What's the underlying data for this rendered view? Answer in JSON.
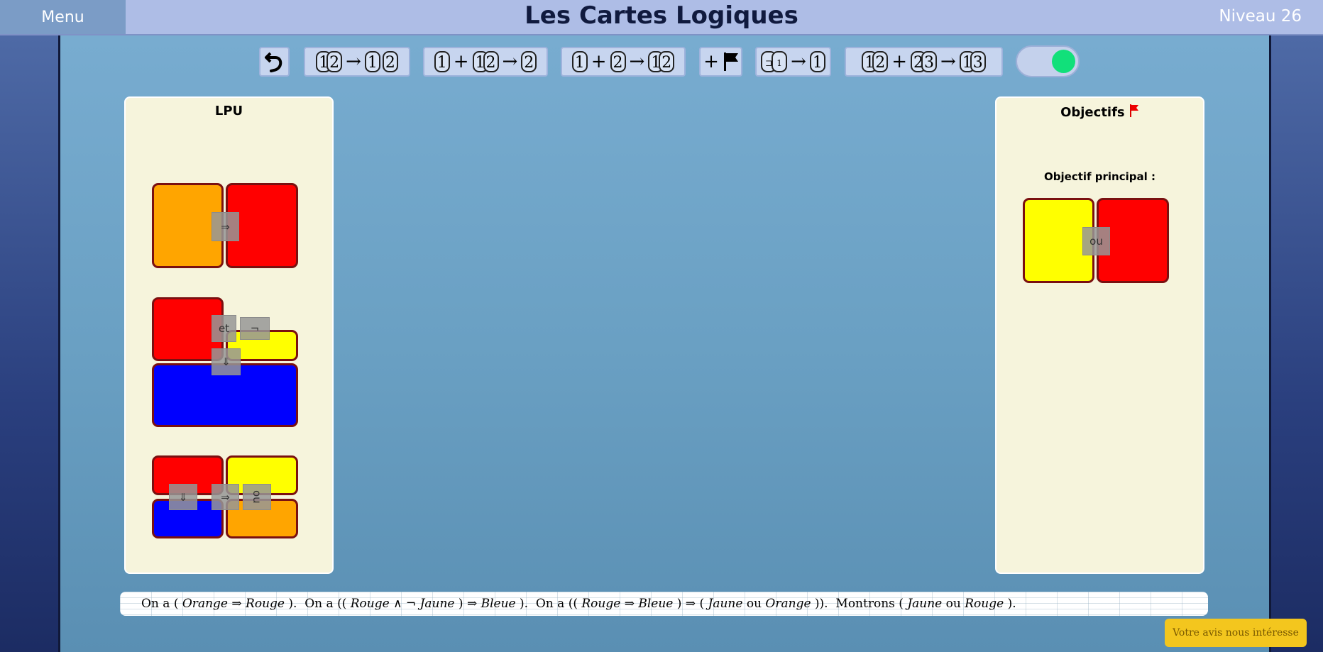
{
  "header": {
    "menu_label": "Menu",
    "title": "Les Cartes Logiques",
    "level": "Niveau 26"
  },
  "toolbar": {
    "undo_icon": "undo-arrow-icon",
    "rules": [
      {
        "name": "and-elimination",
        "parts": [
          "1∧2",
          "→",
          "1",
          "2"
        ]
      },
      {
        "name": "modus-ponens",
        "parts": [
          "1",
          "+",
          "1⇒2",
          "→",
          "2"
        ]
      },
      {
        "name": "and-introduction",
        "parts": [
          "1",
          "+",
          "2",
          "→",
          "1∧2"
        ]
      },
      {
        "name": "add-goal",
        "parts": [
          "+",
          "flag"
        ]
      },
      {
        "name": "implication-intro",
        "parts": [
          "⊐1",
          "→",
          "1"
        ]
      },
      {
        "name": "transitivity",
        "parts": [
          "1⇒2",
          "+",
          "2⇒3",
          "→",
          "1⇒3"
        ]
      }
    ],
    "toggle_on": true
  },
  "lpu_panel": {
    "title": "LPU",
    "cards": [
      {
        "ops": [
          "⇒"
        ],
        "colors": [
          "#ffa500",
          "#ff0000"
        ]
      },
      {
        "ops": [
          "et",
          "¬",
          "⇓"
        ],
        "colors": [
          "#ff0000",
          "#ffff00",
          "#0000ff"
        ]
      },
      {
        "ops": [
          "⇓",
          "⇒",
          "ou"
        ],
        "colors": [
          "#ff0000",
          "#ffff00",
          "#0000ff",
          "#ffa500"
        ]
      }
    ]
  },
  "objectives_panel": {
    "title": "Objectifs",
    "flag_icon": "red-flag-icon",
    "main_label": "Objectif principal :",
    "goal_op": "ou",
    "goal_colors": [
      "#ffff00",
      "#ff0000"
    ]
  },
  "statement": {
    "s1_prefix": "On a (",
    "s1_a": "Orange",
    "s1_op": "⇒",
    "s1_b": "Rouge",
    "s1_suffix": ").",
    "s2_prefix": "On a ((",
    "s2_a": "Rouge",
    "s2_op1": "∧ ¬",
    "s2_b": "Jaune",
    "s2_mid": ") ⇒",
    "s2_c": "Bleue",
    "s2_suffix": ").",
    "s3_prefix": "On a ((",
    "s3_a": "Rouge",
    "s3_op1": "⇒",
    "s3_b": "Bleue",
    "s3_mid": ") ⇒ (",
    "s3_c": "Jaune",
    "s3_or": "ou",
    "s3_d": "Orange",
    "s3_suffix": ")).",
    "s4_prefix": "Montrons (",
    "s4_a": "Jaune",
    "s4_or": "ou",
    "s4_b": "Rouge",
    "s4_suffix": ")."
  },
  "feedback_label": "Votre avis nous intéresse"
}
